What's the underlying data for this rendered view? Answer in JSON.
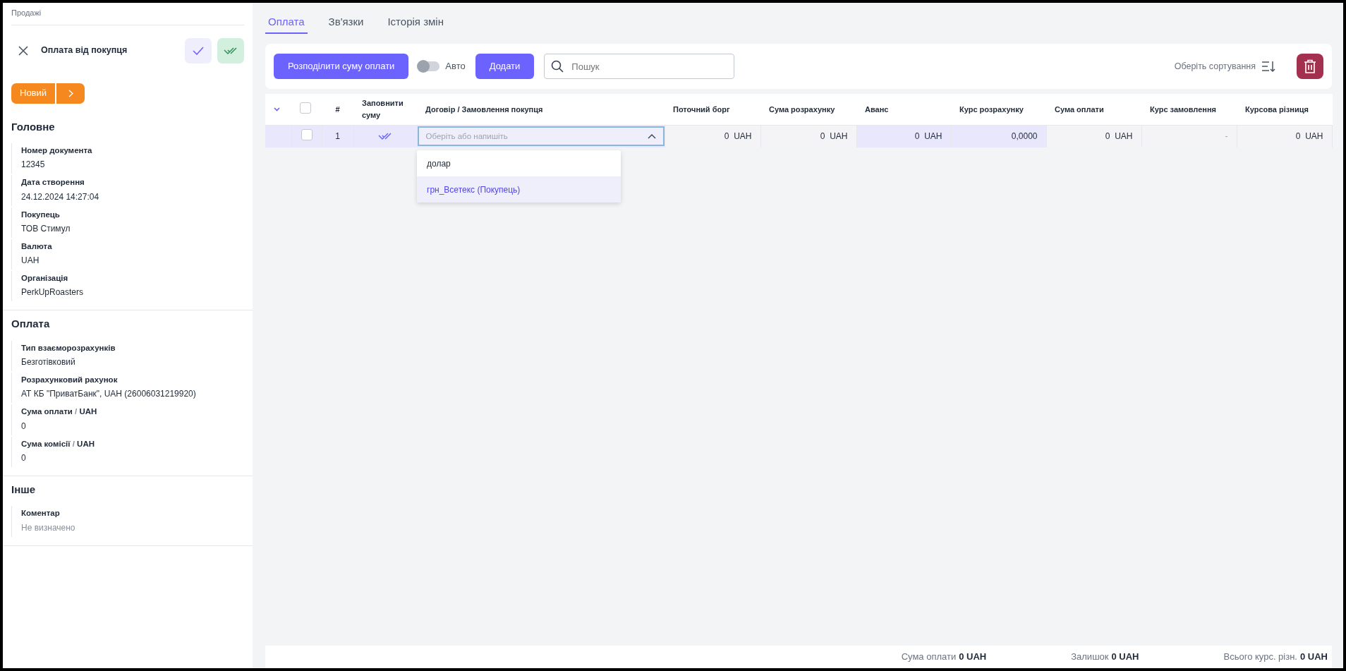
{
  "breadcrumb": "Продажі",
  "document": {
    "title": "Оплата від покупця",
    "status": "Новий"
  },
  "sections": [
    {
      "title": "Головне",
      "fields": [
        {
          "label": "Номер документа",
          "value": "12345"
        },
        {
          "label": "Дата створення",
          "value": "24.12.2024 14:27:04"
        },
        {
          "label": "Покупець",
          "value": "ТОВ Стимул"
        },
        {
          "label": "Валюта",
          "value": "UAH"
        },
        {
          "label": "Організація",
          "value": "PerkUpRoasters"
        }
      ]
    },
    {
      "title": "Оплата",
      "fields": [
        {
          "label": "Тип взаєморозрахунків",
          "value": "Безготівковий"
        },
        {
          "label": "Розрахунковий рахунок",
          "value": "АТ КБ \"ПриватБанк\", UAH (26006031219920)"
        },
        {
          "label": "Сума оплати",
          "separator": "/",
          "unit": "UAH",
          "value": "0"
        },
        {
          "label": "Сума комісії",
          "separator": "/",
          "unit": "UAH",
          "value": "0"
        }
      ]
    },
    {
      "title": "Інше",
      "fields": [
        {
          "label": "Коментар",
          "value": "Не визначено",
          "empty": true
        }
      ]
    }
  ],
  "tabs": [
    {
      "label": "Оплата",
      "selected": true
    },
    {
      "label": "Зв'язки",
      "selected": false
    },
    {
      "label": "Історія змін",
      "selected": false
    }
  ],
  "toolbar": {
    "distribute_button": "Розподілити суму оплати",
    "auto_toggle": {
      "label": "Авто",
      "on": false
    },
    "add_button": "Додати",
    "search": {
      "placeholder": "Пошук"
    },
    "sort_label": "Оберіть сортування"
  },
  "table": {
    "columns": [
      "#",
      "Заповнити суму",
      "Договір / Замовлення покупця",
      "Поточний борг",
      "Сума розрахунку",
      "Аванс",
      "Курс розрахунку",
      "Сума оплати",
      "Курс замовлення",
      "Курсова різниця"
    ],
    "all_checked": false,
    "rows": [
      {
        "checked": false,
        "cells": [
          {
            "kind": "number",
            "value": "1"
          },
          {
            "kind": "fill"
          },
          {
            "kind": "select",
            "placeholder": "Оберіть або напишіть",
            "expanded": true
          },
          {
            "value": "0  UAH",
            "editable": false
          },
          {
            "value": "0  UAH",
            "editable": false
          },
          {
            "value": "0  UAH",
            "editable": true
          },
          {
            "value": "0,0000",
            "editable": true
          },
          {
            "value": "0  UAH",
            "editable": false
          },
          {
            "value": "-",
            "editable": false
          },
          {
            "value": "0  UAH",
            "editable": false
          }
        ]
      }
    ]
  },
  "dropdown": [
    {
      "label": "долар",
      "selected": false
    },
    {
      "label": "грн_Всетекс (Покупець)",
      "selected": true
    }
  ],
  "totals": [
    {
      "label": "Сума оплати",
      "value": "0 UAH"
    },
    {
      "label": "Залишок",
      "value": "0 UAH"
    },
    {
      "label": "Всього курс. різн.",
      "value": "0 UAH"
    }
  ]
}
